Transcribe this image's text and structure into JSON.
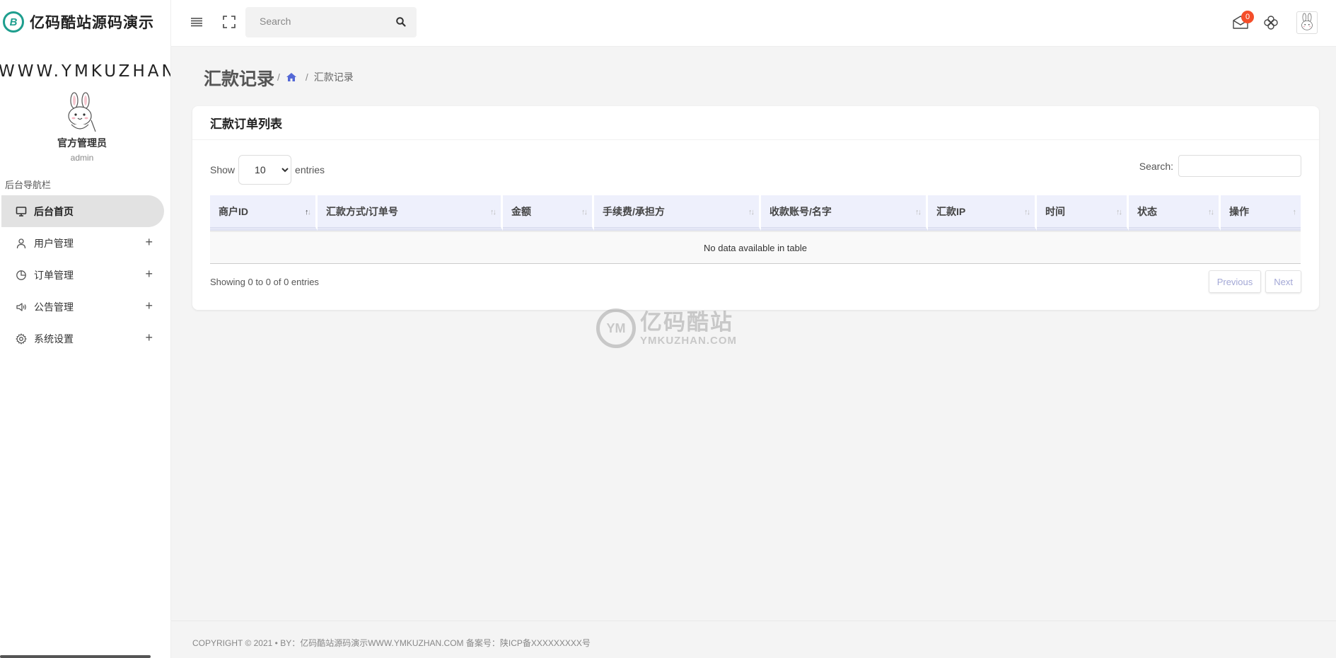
{
  "brand": {
    "logo_glyph": "B",
    "name": "亿码酷站源码演示",
    "url_text": "WWW.YMKUZHAN.CC"
  },
  "user": {
    "name": "官方管理员",
    "role": "admin"
  },
  "sidebar": {
    "heading": "后台导航栏",
    "items": [
      {
        "label": "后台首页",
        "icon": "monitor-icon",
        "active": true
      },
      {
        "label": "用户管理",
        "icon": "user-icon",
        "expand": "+"
      },
      {
        "label": "订单管理",
        "icon": "pie-chart-icon",
        "expand": "+"
      },
      {
        "label": "公告管理",
        "icon": "speaker-icon",
        "expand": "+"
      },
      {
        "label": "系统设置",
        "icon": "gear-icon",
        "expand": "+"
      }
    ]
  },
  "topbar": {
    "search_placeholder": "Search",
    "notification_count": "0"
  },
  "page": {
    "title": "汇款记录",
    "breadcrumb_sep": "/",
    "breadcrumb_current": "汇款记录"
  },
  "card": {
    "title": "汇款订单列表",
    "show_label": "Show",
    "entries_label": "entries",
    "page_length": "10",
    "page_length_options": [
      "10"
    ],
    "search_label": "Search:",
    "columns": [
      "商户ID",
      "汇款方式/订单号",
      "金额",
      "手续费/承担方",
      "收款账号/名字",
      "汇款IP",
      "时间",
      "状态",
      "操作"
    ],
    "empty_text": "No data available in table",
    "info_text": "Showing 0 to 0 of 0 entries",
    "prev_label": "Previous",
    "next_label": "Next"
  },
  "watermark": {
    "glyph": "YM",
    "cn": "亿码酷站",
    "en": "YMKUZHAN.COM"
  },
  "footer": {
    "text": "COPYRIGHT © 2021  • BY：亿码酷站源码演示WWW.YMKUZHAN.COM    备案号：陕ICP备XXXXXXXXX号"
  },
  "colors": {
    "accent": "#5468d6",
    "brand_teal": "#1e9e8e",
    "badge": "#f44e2a",
    "table_header": "#eef0fc"
  }
}
